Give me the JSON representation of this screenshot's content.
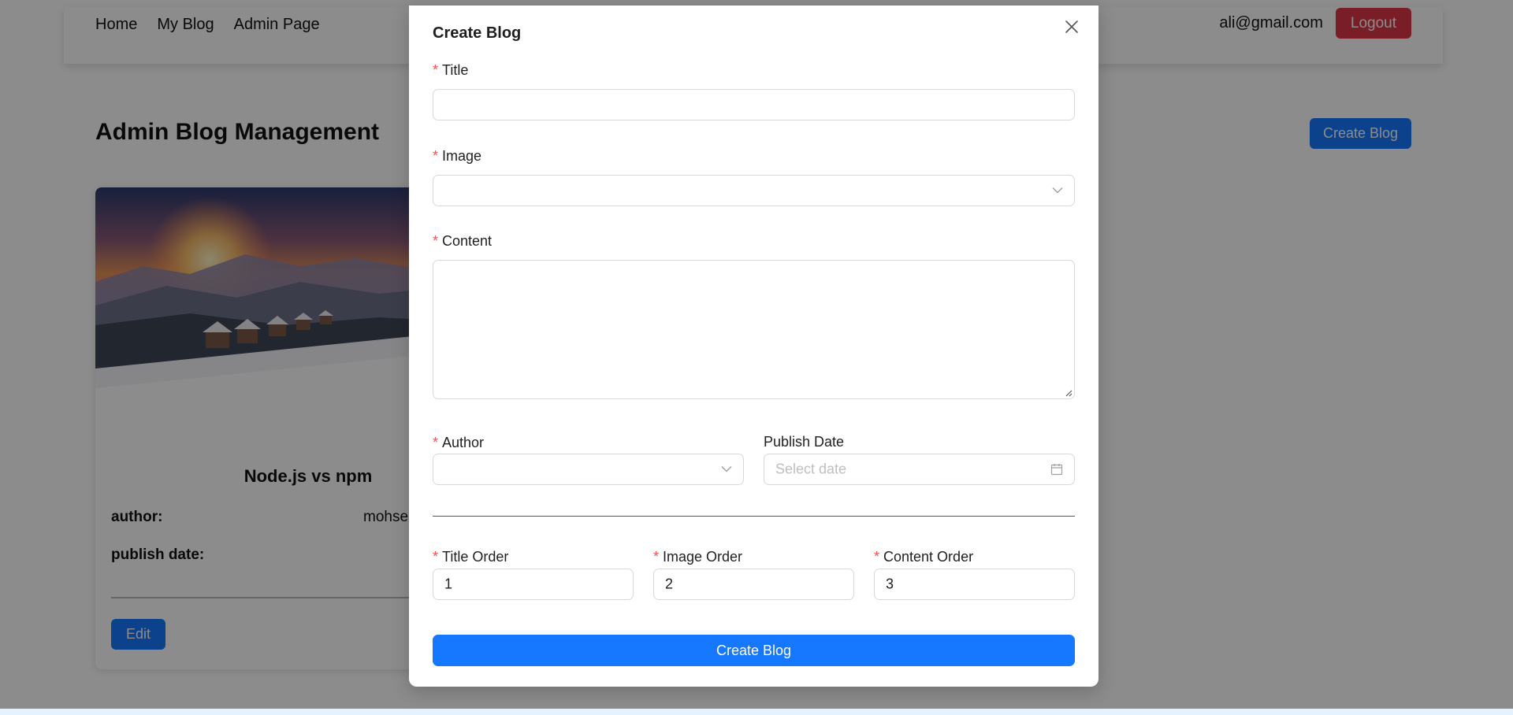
{
  "navbar": {
    "links": [
      "Home",
      "My Blog",
      "Admin Page"
    ],
    "email": "ali@gmail.com",
    "logout_label": "Logout"
  },
  "page": {
    "title": "Admin Blog Management",
    "create_button_label": "Create Blog"
  },
  "blog_card": {
    "title": "Node.js vs npm",
    "author_label": "author:",
    "author_value": "mohse",
    "publish_date_label": "publish date:",
    "edit_label": "Edit"
  },
  "modal": {
    "title": "Create Blog",
    "fields": {
      "title": {
        "label": "Title",
        "required": true,
        "value": ""
      },
      "image": {
        "label": "Image",
        "required": true,
        "value": ""
      },
      "content": {
        "label": "Content",
        "required": true,
        "value": ""
      },
      "author": {
        "label": "Author",
        "required": true,
        "value": ""
      },
      "publish_date": {
        "label": "Publish Date",
        "required": false,
        "placeholder": "Select date"
      },
      "title_order": {
        "label": "Title Order",
        "required": true,
        "value": "1"
      },
      "image_order": {
        "label": "Image Order",
        "required": true,
        "value": "2"
      },
      "content_order": {
        "label": "Content Order",
        "required": true,
        "value": "3"
      }
    },
    "submit_label": "Create Blog"
  },
  "colors": {
    "primary": "#1677ff",
    "danger": "#dc3545",
    "required_mark": "#ff4d4f"
  },
  "icons": [
    "close-icon",
    "chevron-down-icon",
    "calendar-icon",
    "resize-grip-icon"
  ]
}
